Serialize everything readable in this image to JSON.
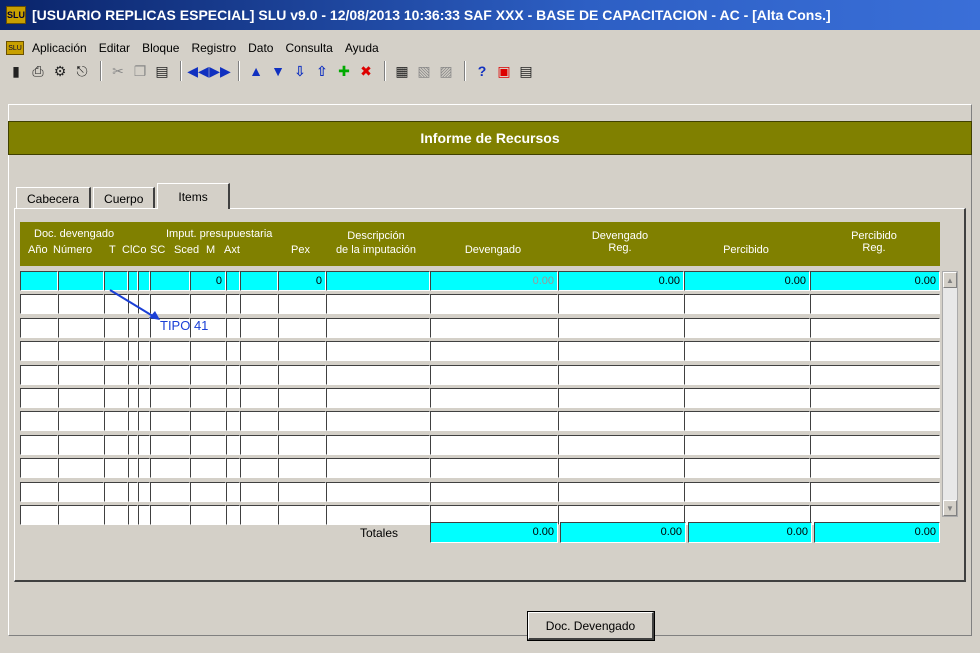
{
  "window": {
    "title": "[USUARIO REPLICAS ESPECIAL]  SLU v9.0 - 12/08/2013 10:36:33 SAF XXX - BASE DE CAPACITACION - AC - [Alta Cons.]",
    "app_icon": "slu-app-icon"
  },
  "menu": [
    "Aplicación",
    "Editar",
    "Bloque",
    "Registro",
    "Dato",
    "Consulta",
    "Ayuda"
  ],
  "toolbar": {
    "icons": [
      "save-icon",
      "print-icon",
      "print-setup-icon",
      "exit-icon",
      "cut-icon",
      "copy-icon",
      "paste-icon",
      "first-record-icon",
      "last-record-icon",
      "previous-record-icon",
      "next-record-icon",
      "previous-block-icon",
      "next-block-icon",
      "insert-record-icon",
      "delete-record-icon",
      "query-icon",
      "execute-query-icon",
      "cancel-query-icon",
      "help-icon",
      "list-icon",
      "details-icon"
    ]
  },
  "form": {
    "title": "Informe de Recursos",
    "tabs": [
      "Cabecera",
      "Cuerpo",
      "Items"
    ],
    "active_tab": "Items"
  },
  "grid": {
    "group_headers": {
      "doc": "Doc. devengado",
      "imput": "Imput. presupuestaria"
    },
    "columns": [
      "Año",
      "Número",
      "T",
      "ClCo",
      "SC",
      "Sced",
      "M",
      "Axt",
      "Pex",
      "Descripción de la imputación",
      "Devengado",
      "Devengado Reg.",
      "Percibido",
      "Percibido Reg."
    ],
    "header_lines": {
      "desc1": "Descripción",
      "desc2": "de la imputación",
      "dev": "Devengado",
      "devreg1": "Devengado",
      "devreg2": "Reg.",
      "perc": "Percibido",
      "percreg1": "Percibido",
      "percreg2": "Reg."
    },
    "first_row": {
      "sced": "0",
      "pex": "0",
      "devengado": "0.00",
      "devengado_reg": "0.00",
      "percibido": "0.00",
      "percibido_reg": "0.00"
    },
    "row_count": 11
  },
  "annotation": {
    "label": "TIPO 41",
    "color": "#1a3fd6"
  },
  "totals": {
    "label": "Totales",
    "devengado": "0.00",
    "devengado_reg": "0.00",
    "percibido": "0.00",
    "percibido_reg": "0.00"
  },
  "buttons": {
    "doc_devengado": "Doc. Devengado"
  }
}
